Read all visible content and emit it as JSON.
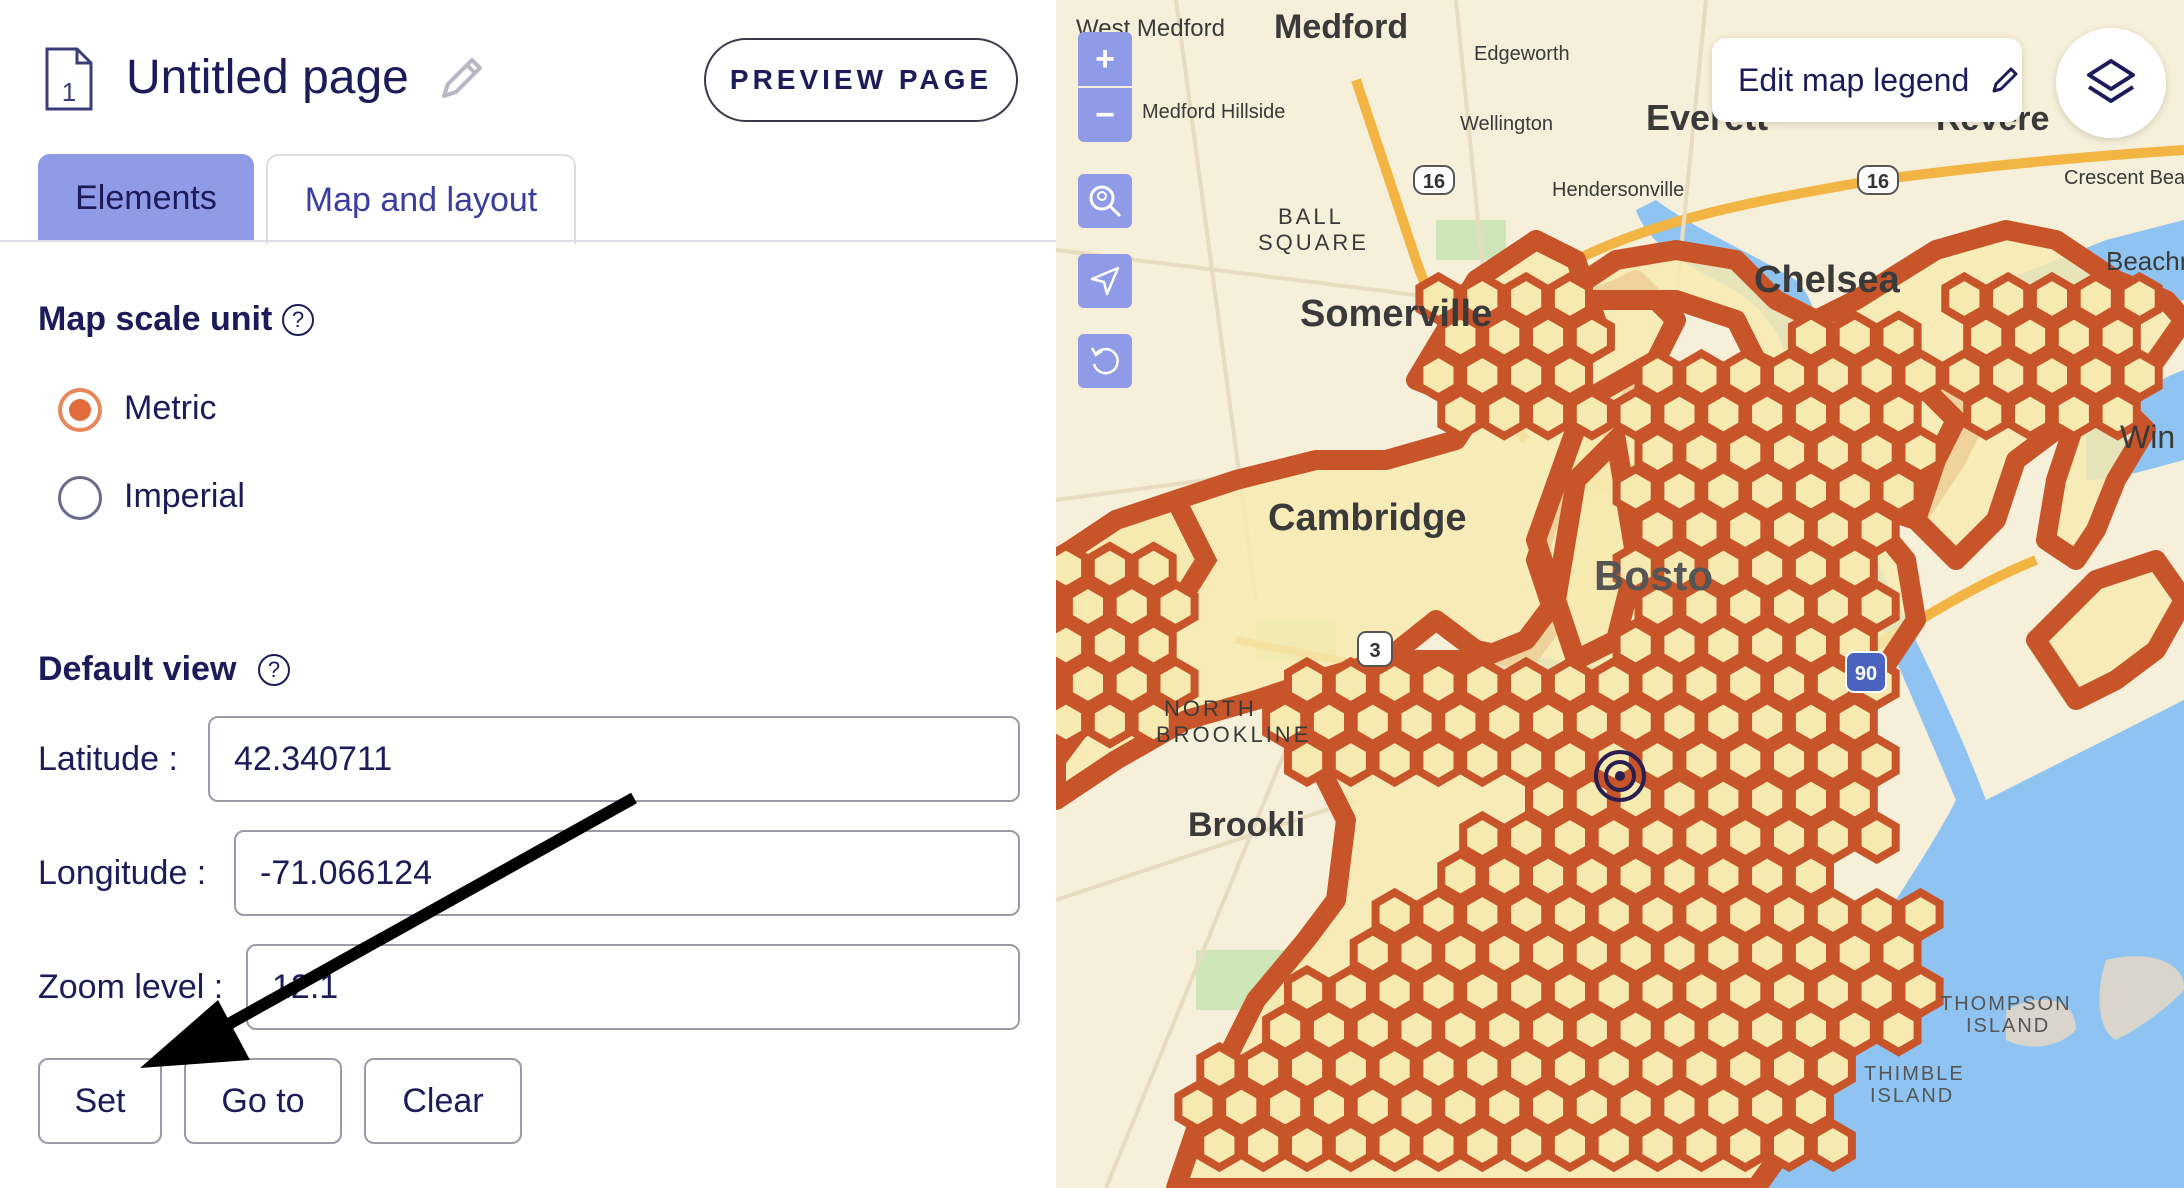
{
  "page": {
    "title": "Untitled page",
    "preview_button": "PREVIEW PAGE",
    "page_number": "1"
  },
  "tabs": [
    {
      "label": "Elements",
      "active": false
    },
    {
      "label": "Map and layout",
      "active": true
    }
  ],
  "map_scale": {
    "title": "Map scale unit",
    "help": "?",
    "options": [
      {
        "label": "Metric",
        "selected": true
      },
      {
        "label": "Imperial",
        "selected": false
      }
    ]
  },
  "default_view": {
    "title": "Default view",
    "help": "?",
    "latitude_label": "Latitude :",
    "latitude_value": "42.340711",
    "longitude_label": "Longitude :",
    "longitude_value": "-71.066124",
    "zoom_label": "Zoom level :",
    "zoom_value": "12.1",
    "buttons": {
      "set": "Set",
      "go_to": "Go to",
      "clear": "Clear"
    }
  },
  "map": {
    "zoom_in": "+",
    "zoom_out": "−",
    "legend_button": "Edit map legend",
    "place_labels": {
      "west_medford": "West Medford",
      "medford": "Medford",
      "edgeworth": "Edgeworth",
      "medford_hillside": "Medford Hillside",
      "wellington": "Wellington",
      "everett": "Everett",
      "revere": "Revere",
      "crescent_beach": "Crescent Bea",
      "hendersonville": "Hendersonville",
      "ball_square_1": "BALL",
      "ball_square_2": "SQUARE",
      "chelsea": "Chelsea",
      "beachmont": "Beachm",
      "somerville": "Somerville",
      "winthrop": "Win",
      "cambridge": "Cambridge",
      "boston": "Bosto",
      "north_brookline_1": "NORTH",
      "north_brookline_2": "BROOKLINE",
      "brookline": "Brookli",
      "thompson_island_1": "THOMPSON",
      "thompson_island_2": "ISLAND",
      "thimble_island_1": "THIMBLE",
      "thimble_island_2": "ISLAND",
      "route_16a": "16",
      "route_16b": "16",
      "route_3": "3",
      "route_90": "90"
    },
    "colors": {
      "land": "#f6efd9",
      "water": "#8fc4f2",
      "hex_fill": "#f7eab0",
      "hex_stroke": "#c8552a",
      "highway": "#f2b443"
    }
  }
}
